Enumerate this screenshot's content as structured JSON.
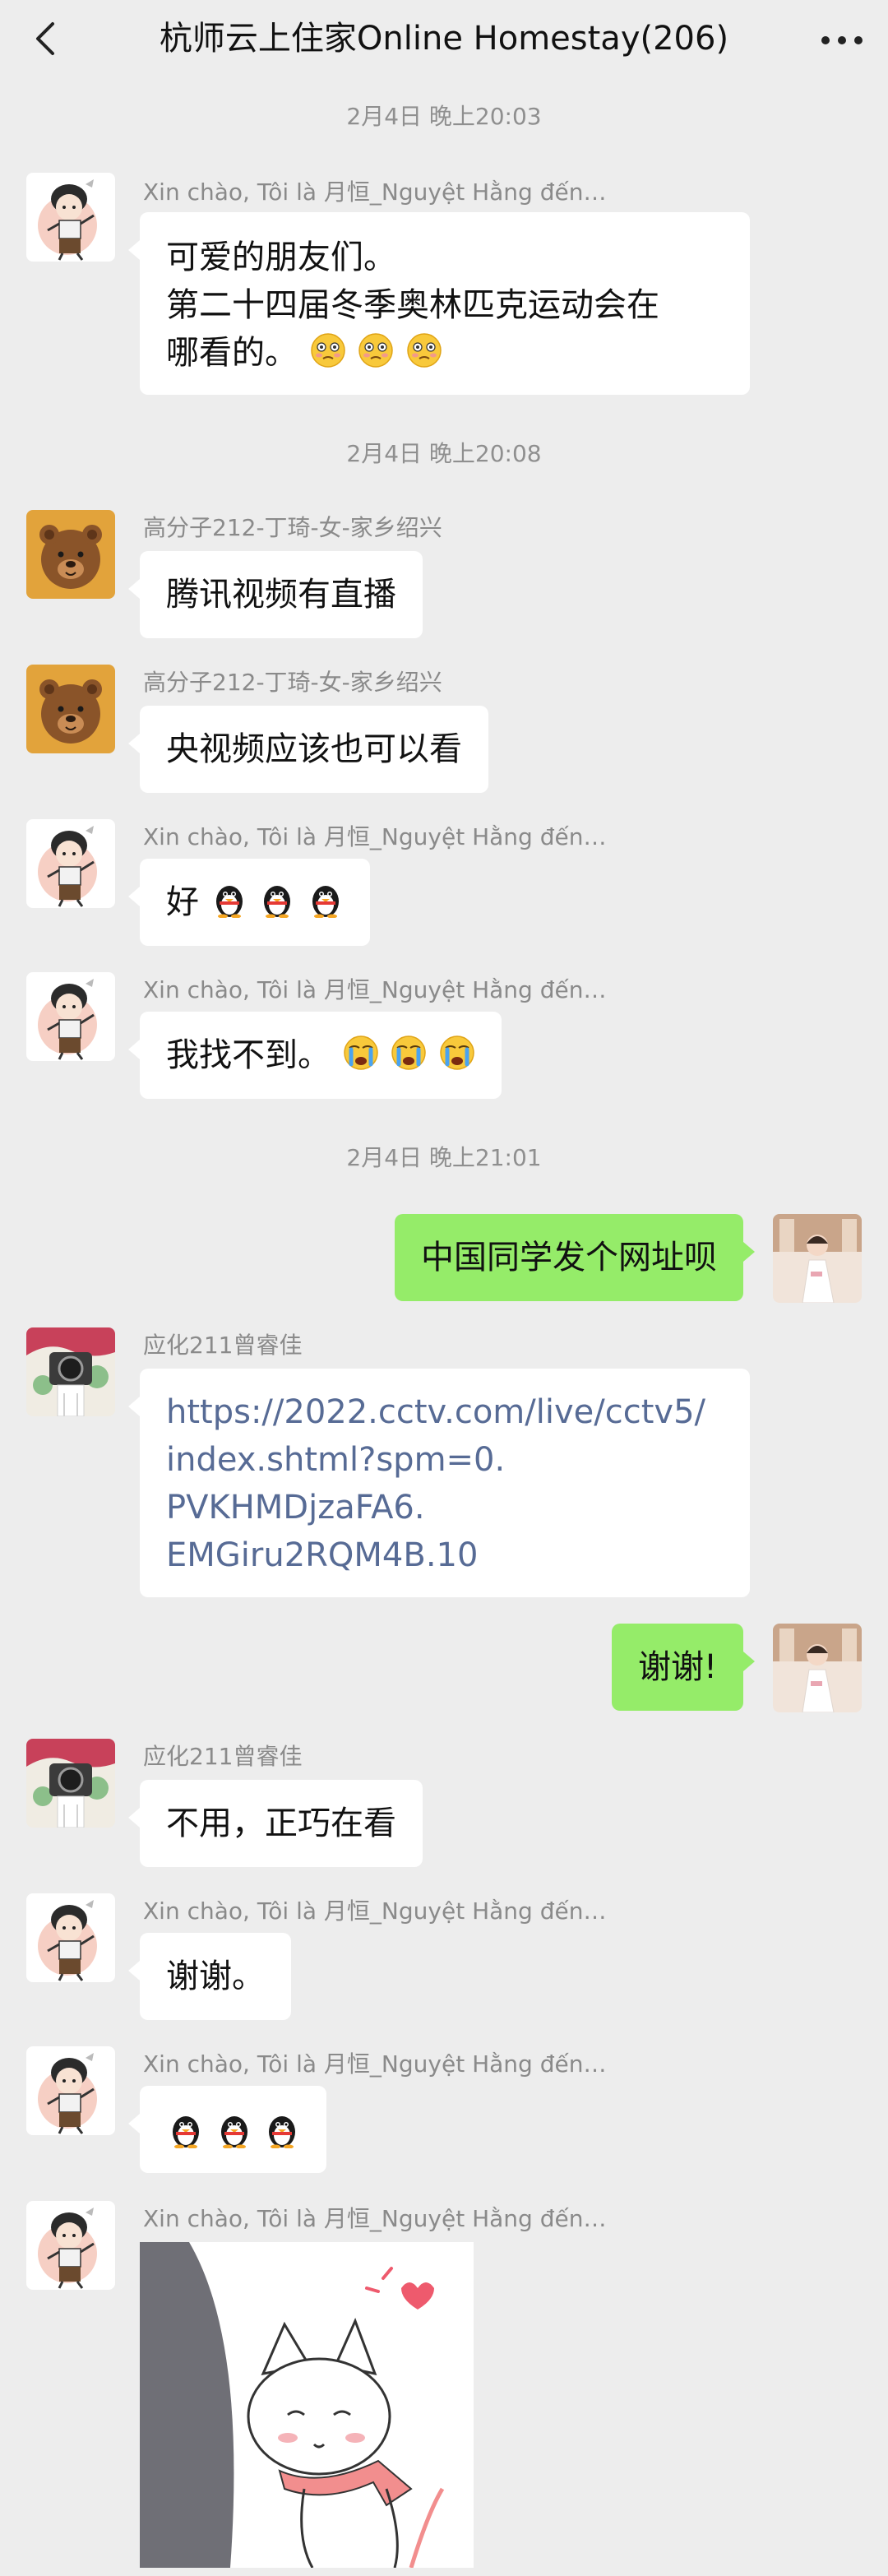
{
  "header": {
    "title": "杭师云上住家Online Homestay(206)"
  },
  "messages": {
    "ts1": "2月4日 晚上20:03",
    "m1_sender": "Xin chào, Tôi là 月恒_Nguyệt Hằng đến…",
    "m1_line1": "可爱的朋友们。",
    "m1_line2": "第二十四届冬季奥林匹克运动会在",
    "m1_line3": "哪看的。",
    "ts2": "2月4日 晚上20:08",
    "m2_sender": "高分子212-丁琦-女-家乡绍兴",
    "m2_text": "腾讯视频有直播",
    "m3_sender": "高分子212-丁琦-女-家乡绍兴",
    "m3_text": "央视频应该也可以看",
    "m4_sender": "Xin chào, Tôi là 月恒_Nguyệt Hằng đến…",
    "m4_text": "好",
    "m5_sender": "Xin chào, Tôi là 月恒_Nguyệt Hằng đến…",
    "m5_text": "我找不到。",
    "ts3": "2月4日 晚上21:01",
    "m6_text": "中国同学发个网址呗",
    "m7_sender": "应化211曾睿佳",
    "m7_link1": "https://2022.cctv.com/live/cctv5/",
    "m7_link2": "index.shtml?spm=0.",
    "m7_link3": "PVKHMDjzaFA6.",
    "m7_link4": "EMGiru2RQM4B.10",
    "m8_text": "谢谢!",
    "m9_sender": "应化211曾睿佳",
    "m9_text": "不用，正巧在看",
    "m10_sender": "Xin chào, Tôi là 月恒_Nguyệt Hằng đến…",
    "m10_text": "谢谢。",
    "m11_sender": "Xin chào, Tôi là 月恒_Nguyệt Hằng đến…",
    "m12_sender": "Xin chào, Tôi là 月恒_Nguyệt Hằng đến…"
  },
  "icons": {
    "back": "chevron-left-icon",
    "more": "more-dots-icon",
    "emoji_flushed": "flushed-face-emoji",
    "emoji_penguin": "qq-penguin-emoji",
    "emoji_cry": "crying-face-emoji"
  },
  "colors": {
    "background": "#ededed",
    "bubble_in": "#ffffff",
    "bubble_out": "#95ec69",
    "link": "#576b95"
  }
}
